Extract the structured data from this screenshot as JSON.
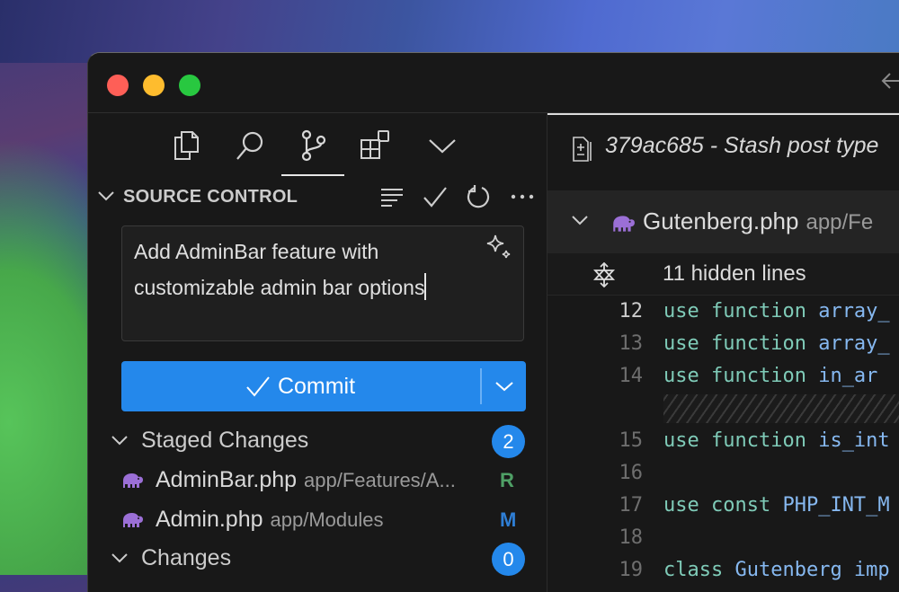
{
  "window": {
    "controls": [
      "close",
      "minimize",
      "zoom"
    ],
    "nav_back_icon": "arrow-left-icon"
  },
  "activity_bar": {
    "items": [
      {
        "name": "explorer",
        "icon": "files-icon"
      },
      {
        "name": "search",
        "icon": "search-icon"
      },
      {
        "name": "source-control",
        "icon": "source-control-icon",
        "active": true
      },
      {
        "name": "extensions",
        "icon": "extensions-icon"
      },
      {
        "name": "more",
        "icon": "chevron-down-icon"
      }
    ]
  },
  "source_control": {
    "title": "SOURCE CONTROL",
    "actions": [
      "view-as-tree",
      "commit",
      "refresh",
      "more-actions"
    ],
    "message": "Add AdminBar feature with customizable admin bar options",
    "commit_label": "Commit",
    "groups": [
      {
        "label": "Staged Changes",
        "count": "2",
        "files": [
          {
            "name": "AdminBar.php",
            "path": "app/Features/A...",
            "status": "R",
            "status_color": "#4fa066"
          },
          {
            "name": "Admin.php",
            "path": "app/Modules",
            "status": "M",
            "status_color": "#2f7fd6"
          }
        ]
      },
      {
        "label": "Changes",
        "count": "0",
        "files": []
      }
    ]
  },
  "editor": {
    "tab_title": "379ac685 - Stash post type",
    "file": {
      "name": "Gutenberg.php",
      "path": "app/Fe"
    },
    "hidden_lines_label": "11 hidden lines",
    "lines": [
      {
        "num": "12",
        "kw": "use function",
        "id": "array_",
        "current": true
      },
      {
        "num": "13",
        "kw": "use function",
        "id": "array_"
      },
      {
        "num": "14",
        "kw": "use function",
        "id": "in_ar"
      },
      {
        "num": "",
        "kw": "",
        "id": "",
        "hatched": true
      },
      {
        "num": "15",
        "kw": "use function",
        "id": "is_int"
      },
      {
        "num": "16",
        "kw": "",
        "id": ""
      },
      {
        "num": "17",
        "kw": "use const",
        "id": "PHP_INT_M"
      },
      {
        "num": "18",
        "kw": "",
        "id": ""
      },
      {
        "num": "19",
        "kw": "class",
        "id": "Gutenberg imp"
      }
    ]
  },
  "colors": {
    "accent": "#2488eb",
    "php_icon": "#9b6fd6",
    "keyword": "#7fcbb8",
    "identifier": "#86b8f0"
  }
}
